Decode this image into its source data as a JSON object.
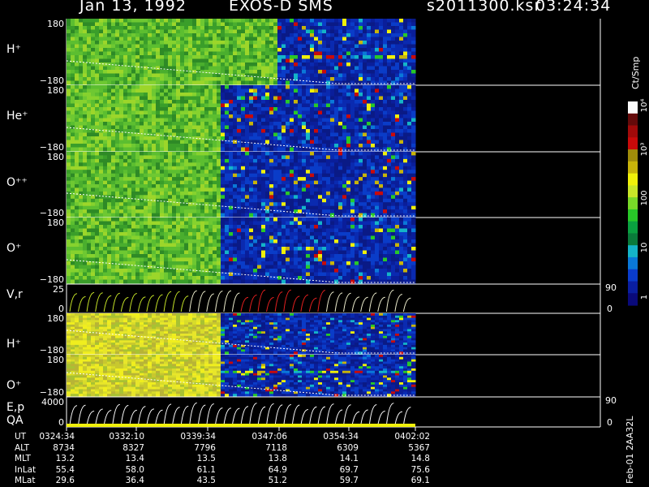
{
  "header": {
    "date": "Jan 13, 1992",
    "instrument": "EXOS-D SMS",
    "file": "s2011300.ksr",
    "time": "03:24:34"
  },
  "colorbar": {
    "title": "Ct/Smp",
    "ticks": [
      "1",
      "10",
      "100",
      "10³",
      "10⁴"
    ],
    "colors": [
      "#0a0a7a",
      "#0a1ea0",
      "#0a3ccc",
      "#0a78d8",
      "#14b4c8",
      "#0a7a3a",
      "#0aa040",
      "#28c828",
      "#78d828",
      "#c8e628",
      "#f0f00a",
      "#c8b40a",
      "#a08c0a",
      "#c80a0a",
      "#a00a0a",
      "#640a0a",
      "#fafafa"
    ]
  },
  "footer": {
    "stamp": "Feb-01 2AA32L"
  },
  "chart_data": {
    "type": "heatmap",
    "x_label_rows": [
      "UT",
      "ALT",
      "MLT",
      "InLat",
      "MLat"
    ],
    "x_ticks": [
      "0324:34",
      "0332:10",
      "0339:34",
      "0347:06",
      "0354:34",
      "0402:02"
    ],
    "ephemeris": {
      "UT": [
        "0324:34",
        "0332:10",
        "0339:34",
        "0347:06",
        "0354:34",
        "0402:02"
      ],
      "ALT": [
        "8734",
        "8327",
        "7796",
        "7118",
        "6309",
        "5367"
      ],
      "MLT": [
        "13.2",
        "13.4",
        "13.5",
        "13.8",
        "14.1",
        "14.8"
      ],
      "InLat": [
        "55.4",
        "58.0",
        "61.1",
        "64.9",
        "69.7",
        "75.6"
      ],
      "MLat": [
        "29.6",
        "36.4",
        "43.5",
        "51.2",
        "59.7",
        "69.1"
      ]
    },
    "panels": [
      {
        "label": "H⁺",
        "ymax": "180",
        "ymin": "−180",
        "kind": "spectrogram",
        "data_end": 0.8,
        "quiet_after": 0.6,
        "band": "green-mix"
      },
      {
        "label": "He⁺",
        "ymax": "180",
        "ymin": "−180",
        "kind": "spectrogram",
        "data_end": 0.8,
        "quiet_after": 0.44,
        "band": "green"
      },
      {
        "label": "O⁺⁺",
        "ymax": "180",
        "ymin": "−180",
        "kind": "spectrogram",
        "data_end": 0.8,
        "quiet_after": 0.44,
        "band": "green"
      },
      {
        "label": "O⁺",
        "ymax": "180",
        "ymin": "−180",
        "kind": "spectrogram",
        "data_end": 0.8,
        "quiet_after": 0.44,
        "band": "green"
      },
      {
        "label": "V,r",
        "ymax": "25",
        "ymin": "0",
        "right_top": "90",
        "right_bottom": "0",
        "kind": "lines"
      },
      {
        "label": "H⁺",
        "ymax": "180",
        "ymin": "−180",
        "kind": "spectrogram",
        "data_end": 0.8,
        "quiet_after": 0.44,
        "band": "yellow"
      },
      {
        "label": "O⁺",
        "ymax": "180",
        "ymin": "−180",
        "kind": "spectrogram",
        "data_end": 0.8,
        "quiet_after": 0.44,
        "band": "yellow"
      },
      {
        "label": "E,p",
        "label2": "QA",
        "ymax": "4000",
        "ymin": "0",
        "right_top": "90",
        "right_bottom": "0",
        "kind": "lines"
      }
    ]
  }
}
